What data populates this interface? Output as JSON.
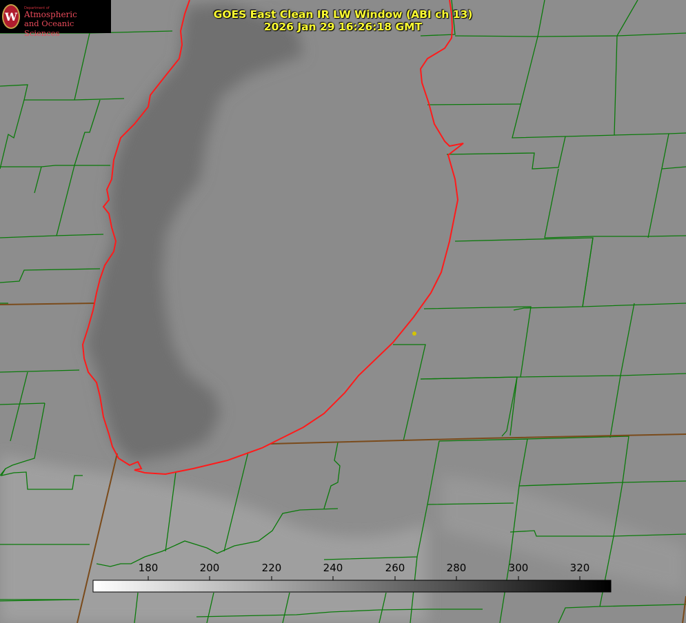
{
  "logo": {
    "department": "Department of",
    "line1": "Atmospheric",
    "line2": "and Oceanic Sciences"
  },
  "title": {
    "line1": "GOES East Clean IR LW Window (ABI ch 13)",
    "line2": "2026 Jan 29 16:26:18 GMT"
  },
  "colorbar": {
    "ticks": [
      "180",
      "200",
      "220",
      "240",
      "260",
      "280",
      "300",
      "320"
    ],
    "gradient_start": "#ffffff",
    "gradient_end": "#000000"
  },
  "colors": {
    "county_lines": "#0a7a0a",
    "state_lines": "#8b4513",
    "lake_shore": "#ff1a1a",
    "title_text": "#ffff33",
    "marker": "#d4c400"
  }
}
